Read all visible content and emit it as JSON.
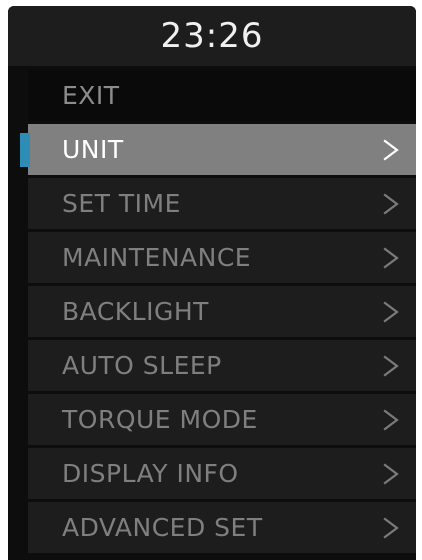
{
  "status": {
    "time": "23:26"
  },
  "menu": {
    "items": [
      {
        "label": "EXIT",
        "selected": false,
        "has_submenu": false
      },
      {
        "label": "UNIT",
        "selected": true,
        "has_submenu": true
      },
      {
        "label": "SET TIME",
        "selected": false,
        "has_submenu": true
      },
      {
        "label": "MAINTENANCE",
        "selected": false,
        "has_submenu": true
      },
      {
        "label": "BACKLIGHT",
        "selected": false,
        "has_submenu": true
      },
      {
        "label": "AUTO SLEEP",
        "selected": false,
        "has_submenu": true
      },
      {
        "label": "TORQUE MODE",
        "selected": false,
        "has_submenu": true
      },
      {
        "label": "DISPLAY INFO",
        "selected": false,
        "has_submenu": true
      },
      {
        "label": "ADVANCED SET",
        "selected": false,
        "has_submenu": true
      }
    ]
  },
  "colors": {
    "background": "#0d0d0d",
    "item_background": "#1d1d1d",
    "selected_background": "#808080",
    "selection_accent": "#2d8db5",
    "text_primary": "#ffffff",
    "text_dim": "#7f7f7f"
  },
  "icons": {
    "submenu": "chevron-right-icon",
    "selection": "selection-marker"
  }
}
